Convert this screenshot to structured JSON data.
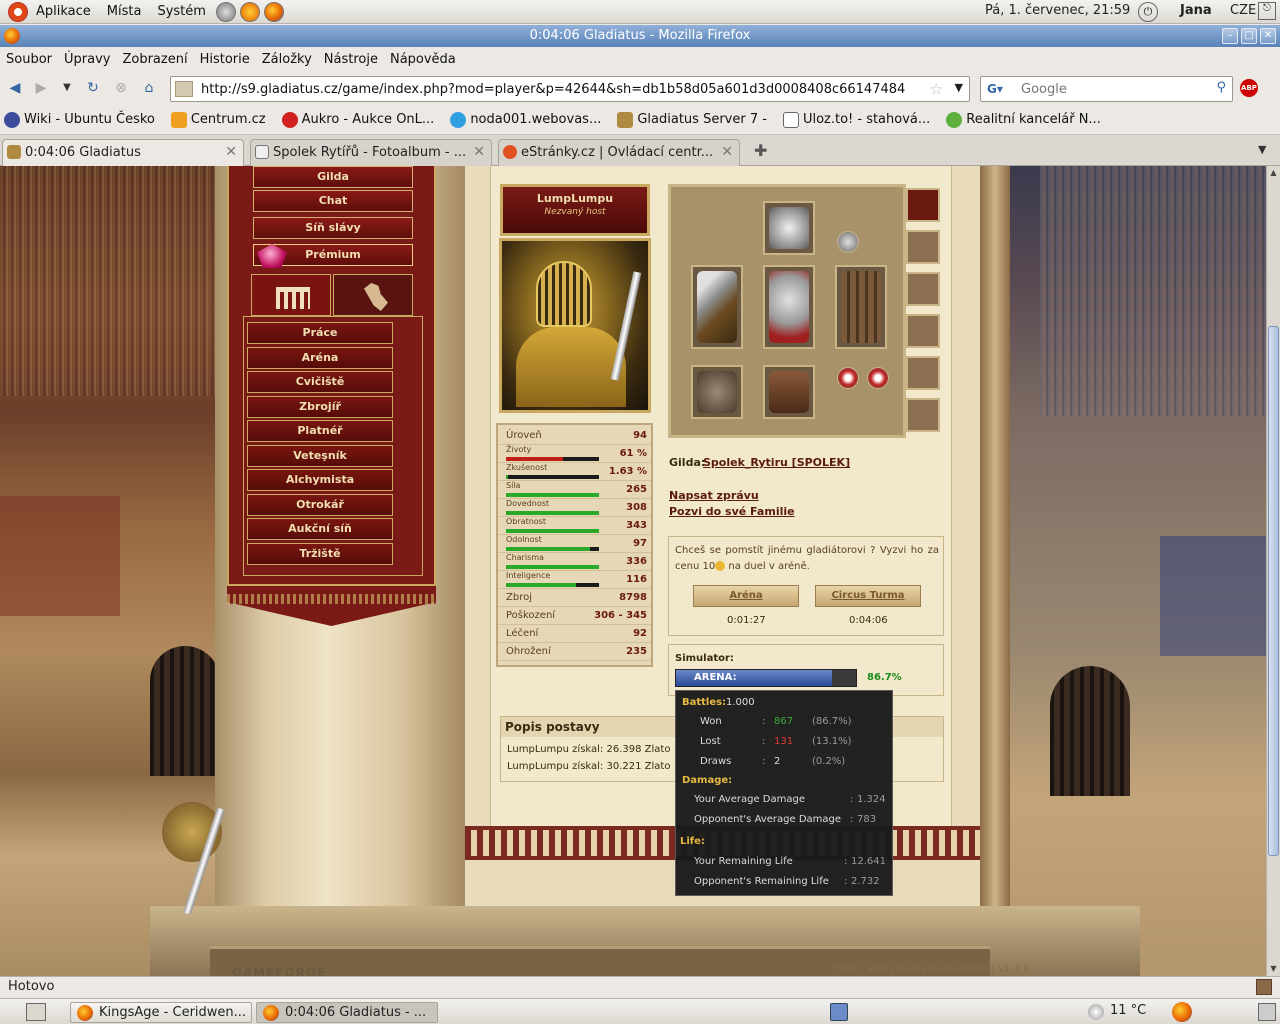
{
  "top_panel": {
    "menus": [
      "Aplikace",
      "Místa",
      "Systém"
    ],
    "clock": "Pá,  1. červenec, 21:59",
    "user": "Jana",
    "keyboard": "CZE"
  },
  "window": {
    "title": "0:04:06 Gladiatus - Mozilla Firefox"
  },
  "menubar": [
    "Soubor",
    "Úpravy",
    "Zobrazení",
    "Historie",
    "Záložky",
    "Nástroje",
    "Nápověda"
  ],
  "navbar": {
    "url": "http://s9.gladiatus.cz/game/index.php?mod=player&p=42644&sh=db1b58d05a601d3d0008408c66147484",
    "search_placeholder": "Google"
  },
  "bookmarks": [
    {
      "label": "Wiki - Ubuntu Česko",
      "icon": "ubuntu-icon",
      "color": "#3b4d9b"
    },
    {
      "label": "Centrum.cz",
      "icon": "centrum-icon",
      "color": "#f0a020"
    },
    {
      "label": "Aukro - Aukce OnL...",
      "icon": "aukro-icon",
      "color": "#d02020"
    },
    {
      "label": "noda001.webovas...",
      "icon": "webnode-icon",
      "color": "#30a0e0"
    },
    {
      "label": "Gladiatus Server 7 -",
      "icon": "gladiatus-icon",
      "color": "#b08a40"
    },
    {
      "label": "Uloz.to! - stahová...",
      "icon": "ulozto-icon",
      "color": "#c0c0c0"
    },
    {
      "label": "Realitní kancelář N...",
      "icon": "realty-icon",
      "color": "#60b040"
    }
  ],
  "tabs": [
    {
      "label": "0:04:06 Gladiatus",
      "active": true
    },
    {
      "label": "Spolek Rytířů - Fotoalbum - ...",
      "active": false
    },
    {
      "label": "eStránky.cz | Ovládací centr...",
      "active": false
    }
  ],
  "game": {
    "top_menu": [
      "Gilda",
      "Chat",
      "Síň slávy",
      "Prémium"
    ],
    "nav": [
      "Práce",
      "Aréna",
      "Cvičiště",
      "Zbrojíř",
      "Platnéř",
      "Veteşník",
      "Alchymista",
      "Otrokář",
      "Aukční síň",
      "Tržiště"
    ],
    "player": {
      "name": "LumpLumpu",
      "title": "Nezvaný host"
    },
    "stats": [
      {
        "label": "Úroveň",
        "value": "94"
      },
      {
        "label": "Životy",
        "value": "61 %",
        "bar": 0.61,
        "bar_color": "#c02018"
      },
      {
        "label": "Zkušenost",
        "value": "1.63 %",
        "bar": 0.0163,
        "bar_color": "#2aa82a"
      },
      {
        "label": "Síla",
        "value": "265",
        "bar": 1.0,
        "bar_color": "#2aa82a"
      },
      {
        "label": "Dovednost",
        "value": "308",
        "bar": 1.0,
        "bar_color": "#2aa82a"
      },
      {
        "label": "Obratnost",
        "value": "343",
        "bar": 1.0,
        "bar_color": "#2aa82a"
      },
      {
        "label": "Odolnost",
        "value": "97",
        "bar": 0.9,
        "bar_color": "#2aa82a"
      },
      {
        "label": "Charisma",
        "value": "336",
        "bar": 1.0,
        "bar_color": "#2aa82a"
      },
      {
        "label": "Inteligence",
        "value": "116",
        "bar": 0.75,
        "bar_color": "#2aa82a"
      },
      {
        "label": "Zbroj",
        "value": "8798"
      },
      {
        "label": "Poškození",
        "value": "306 - 345"
      },
      {
        "label": "Léčení",
        "value": "92"
      },
      {
        "label": "Ohrožení",
        "value": "235"
      }
    ],
    "guild_label": "Gilda:",
    "guild_name": "Spolek_Rytiru [SPOLEK]",
    "links": {
      "message": "Napsat zprávu",
      "family": "Pozvi do své Familie"
    },
    "duel": {
      "text": "Chceš se pomstít jinému gladiátorovi ? Vyzvi ho za cenu 10",
      "text_after": " na duel v aréně.",
      "arena_btn": "Aréna",
      "turma_btn": "Circus Turma",
      "arena_time": "0:01:27",
      "turma_time": "0:04:06"
    },
    "simulator": {
      "label": "Simulator:",
      "bar_text": "ARENA:",
      "value": 0.867,
      "percent": "86.7%"
    },
    "description": {
      "title": "Popis postavy",
      "rows": [
        "LumpLumpu získal: 26.398 Zlato",
        "LumpLumpu získal: 30.221 Zlato"
      ]
    },
    "tooltip": {
      "battles_label": "Battles:",
      "battles": "1.000",
      "won_label": "Won",
      "won": "867",
      "won_pct": "(86.7%)",
      "lost_label": "Lost",
      "lost": "131",
      "lost_pct": "(13.1%)",
      "draws_label": "Draws",
      "draws": "2",
      "draws_pct": "(0.2%)",
      "damage_label": "Damage:",
      "avg_dmg_label": "Your Average Damage",
      "avg_dmg": "1.324",
      "opp_dmg_label": "Opponent's Average Damage",
      "opp_dmg": "783",
      "life_label": "Life:",
      "rem_life_label": "Your Remaining Life",
      "rem_life": "12.641",
      "opp_life_label": "Opponent's Remaining Life",
      "opp_life": "2.732"
    },
    "footer": {
      "links": "Tiráž | VOP | Ochrana soukromí | v1.3.0",
      "logo": "GAMEFORGE"
    }
  },
  "statusbar": {
    "text": "Hotovo"
  },
  "taskbar": [
    {
      "label": "KingsAge - Ceridwen...",
      "active": false
    },
    {
      "label": "0:04:06 Gladiatus - ...",
      "active": true
    }
  ],
  "weather": "11 °C"
}
